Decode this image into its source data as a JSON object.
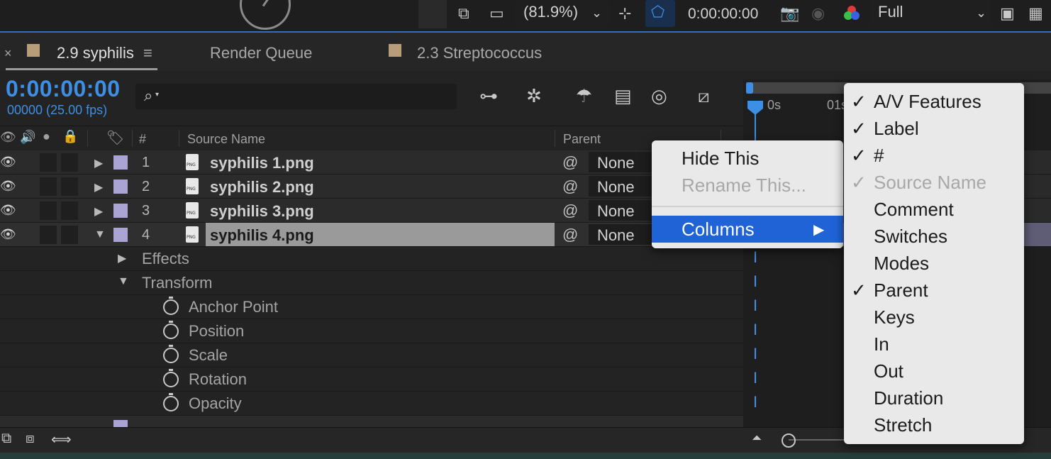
{
  "viewer_bar": {
    "zoom": "(81.9%)",
    "timecode": "0:00:00:00",
    "resolution": "Full"
  },
  "tabs": [
    {
      "label": "2.9 syphilis",
      "color": "#b79e78",
      "active": true
    },
    {
      "label": "Render Queue",
      "active": false
    },
    {
      "label": "2.3 Streptococcus",
      "color": "#b79e78",
      "active": false
    }
  ],
  "timeline_header": {
    "timecode": "0:00:00:00",
    "frame_info": "00000 (25.00 fps)",
    "search_placeholder": ""
  },
  "columns": {
    "number": "#",
    "source_name": "Source Name",
    "parent": "Parent"
  },
  "layers": [
    {
      "num": "1",
      "name": "syphilis 1.png",
      "parent": "None",
      "label_color": "#a9a4d4"
    },
    {
      "num": "2",
      "name": "syphilis 2.png",
      "parent": "None",
      "label_color": "#a9a4d4"
    },
    {
      "num": "3",
      "name": "syphilis 3.png",
      "parent": "None",
      "label_color": "#a9a4d4"
    },
    {
      "num": "4",
      "name": "syphilis 4.png",
      "parent": "None",
      "label_color": "#a9a4d4",
      "selected": true
    }
  ],
  "properties": {
    "effects": "Effects",
    "transform": "Transform",
    "items": [
      "Anchor Point",
      "Position",
      "Scale",
      "Rotation",
      "Opacity"
    ]
  },
  "ruler": {
    "t0": "0s",
    "t1": "01s"
  },
  "context_menu": {
    "hide_this": "Hide This",
    "rename_this": "Rename This...",
    "columns": "Columns",
    "arrow": "▶"
  },
  "columns_submenu": [
    {
      "label": "A/V Features",
      "checked": true
    },
    {
      "label": "Label",
      "checked": true
    },
    {
      "label": "#",
      "checked": true
    },
    {
      "label": "Source Name",
      "checked": true,
      "disabled": true
    },
    {
      "label": "Comment",
      "checked": false
    },
    {
      "label": "Switches",
      "checked": false
    },
    {
      "label": "Modes",
      "checked": false
    },
    {
      "label": "Parent",
      "checked": true
    },
    {
      "label": "Keys",
      "checked": false
    },
    {
      "label": "In",
      "checked": false
    },
    {
      "label": "Out",
      "checked": false
    },
    {
      "label": "Duration",
      "checked": false
    },
    {
      "label": "Stretch",
      "checked": false
    }
  ],
  "check_glyph": "✓",
  "colors": {
    "accent_blue": "#3d8fe6",
    "menu_highlight": "#1f63d7",
    "label_lavender": "#a9a4d4",
    "comp_tan": "#b79e78"
  }
}
